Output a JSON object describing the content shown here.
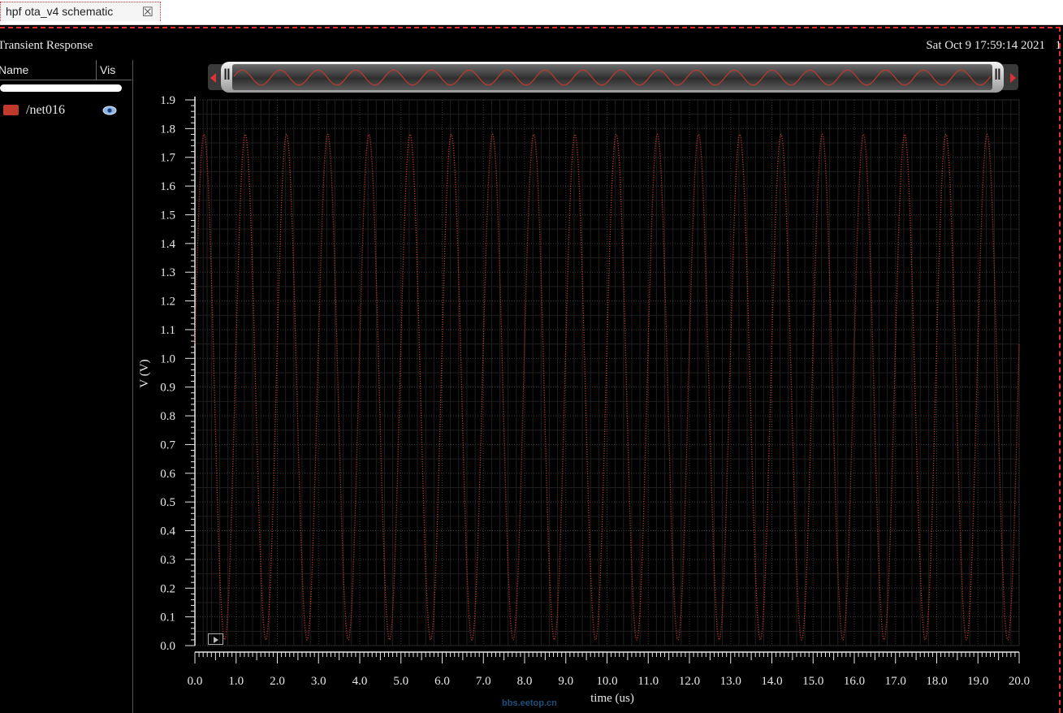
{
  "tab": {
    "label": "hpf ota_v4 schematic",
    "close": "☒"
  },
  "window": {
    "title": "Transient Response",
    "timestamp": "Sat Oct 9 17:59:14 2021",
    "edge_char": "1"
  },
  "legend": {
    "name_header": "Name",
    "vis_header": "Vis",
    "signals": [
      {
        "name": "/net016",
        "color": "#c0392b",
        "icon": "eye-icon"
      }
    ]
  },
  "watermark": "bbs.eetop.cn",
  "chart_data": {
    "type": "line",
    "xlabel": "time (us)",
    "ylabel": "V (V)",
    "xlim": [
      0,
      20
    ],
    "ylim": [
      0,
      1.9
    ],
    "x_ticks": [
      "0.0",
      "1.0",
      "2.0",
      "3.0",
      "4.0",
      "5.0",
      "6.0",
      "7.0",
      "8.0",
      "9.0",
      "10.0",
      "11.0",
      "12.0",
      "13.0",
      "14.0",
      "15.0",
      "16.0",
      "17.0",
      "18.0",
      "19.0",
      "20.0"
    ],
    "y_ticks": [
      "0.0",
      "0.1",
      "0.2",
      "0.3",
      "0.4",
      "0.5",
      "0.6",
      "0.7",
      "0.8",
      "0.9",
      "1.0",
      "1.1",
      "1.2",
      "1.3",
      "1.4",
      "1.5",
      "1.6",
      "1.7",
      "1.8",
      "1.9"
    ],
    "grid": true,
    "series": [
      {
        "name": "/net016",
        "color": "#c0392b",
        "style": "dotted",
        "waveform": "sine",
        "frequency_mhz": 1.0,
        "offset_v": 0.9,
        "amplitude_v": 0.88,
        "phase_deg": 10
      }
    ]
  }
}
